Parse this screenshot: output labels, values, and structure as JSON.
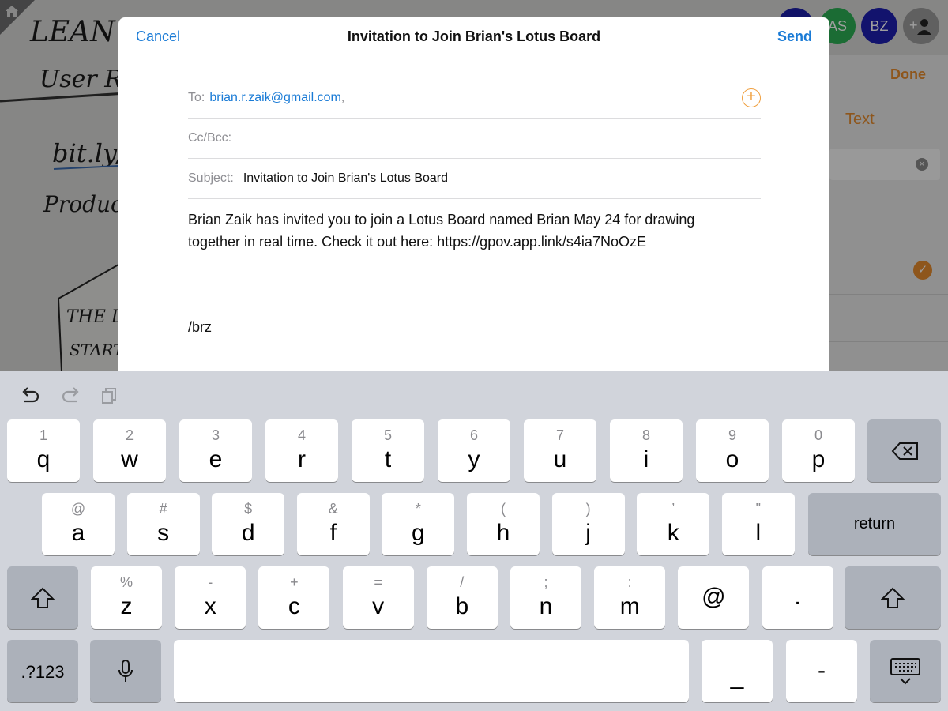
{
  "background": {
    "sketch_lines": [
      "LEAN",
      "User Re",
      "bit.ly/",
      "Product S",
      "THE LE",
      "START"
    ],
    "avatars": [
      {
        "initials": "",
        "color": "#1c1fa8"
      },
      {
        "initials": "AS",
        "color": "#2cae55"
      },
      {
        "initials": "BZ",
        "color": "#1d1fb0"
      }
    ],
    "side_panel": {
      "done_label": "Done",
      "text_tab_label": "Text"
    }
  },
  "compose": {
    "cancel_label": "Cancel",
    "title": "Invitation to Join Brian's Lotus Board",
    "send_label": "Send",
    "to_label": "To:",
    "to_recipient": "brian.r.zaik@gmail.com",
    "to_separator": ",",
    "cc_label": "Cc/Bcc:",
    "subject_label": "Subject:",
    "subject_value": "Invitation to Join Brian's Lotus Board",
    "body_line1": "Brian Zaik has invited you to join a Lotus Board named Brian May 24 for drawing",
    "body_line2": "together in real time. Check it out here: https://gpov.app.link/s4ia7NoOzE",
    "signature": "/brz"
  },
  "keyboard": {
    "row1": [
      {
        "hint": "1",
        "key": "q"
      },
      {
        "hint": "2",
        "key": "w"
      },
      {
        "hint": "3",
        "key": "e"
      },
      {
        "hint": "4",
        "key": "r"
      },
      {
        "hint": "5",
        "key": "t"
      },
      {
        "hint": "6",
        "key": "y"
      },
      {
        "hint": "7",
        "key": "u"
      },
      {
        "hint": "8",
        "key": "i"
      },
      {
        "hint": "9",
        "key": "o"
      },
      {
        "hint": "0",
        "key": "p"
      }
    ],
    "row2": [
      {
        "hint": "@",
        "key": "a"
      },
      {
        "hint": "#",
        "key": "s"
      },
      {
        "hint": "$",
        "key": "d"
      },
      {
        "hint": "&",
        "key": "f"
      },
      {
        "hint": "*",
        "key": "g"
      },
      {
        "hint": "(",
        "key": "h"
      },
      {
        "hint": ")",
        "key": "j"
      },
      {
        "hint": "’",
        "key": "k"
      },
      {
        "hint": "\"",
        "key": "l"
      }
    ],
    "row3": [
      {
        "hint": "%",
        "key": "z"
      },
      {
        "hint": "-",
        "key": "x"
      },
      {
        "hint": "+",
        "key": "c"
      },
      {
        "hint": "=",
        "key": "v"
      },
      {
        "hint": "/",
        "key": "b"
      },
      {
        "hint": ";",
        "key": "n"
      },
      {
        "hint": ":",
        "key": "m"
      },
      {
        "hint": "",
        "key": "@"
      },
      {
        "hint": "",
        "key": "."
      }
    ],
    "return_label": "return",
    "numbers_label": ".?123",
    "underscore_label": "_",
    "dash_label": "-"
  }
}
